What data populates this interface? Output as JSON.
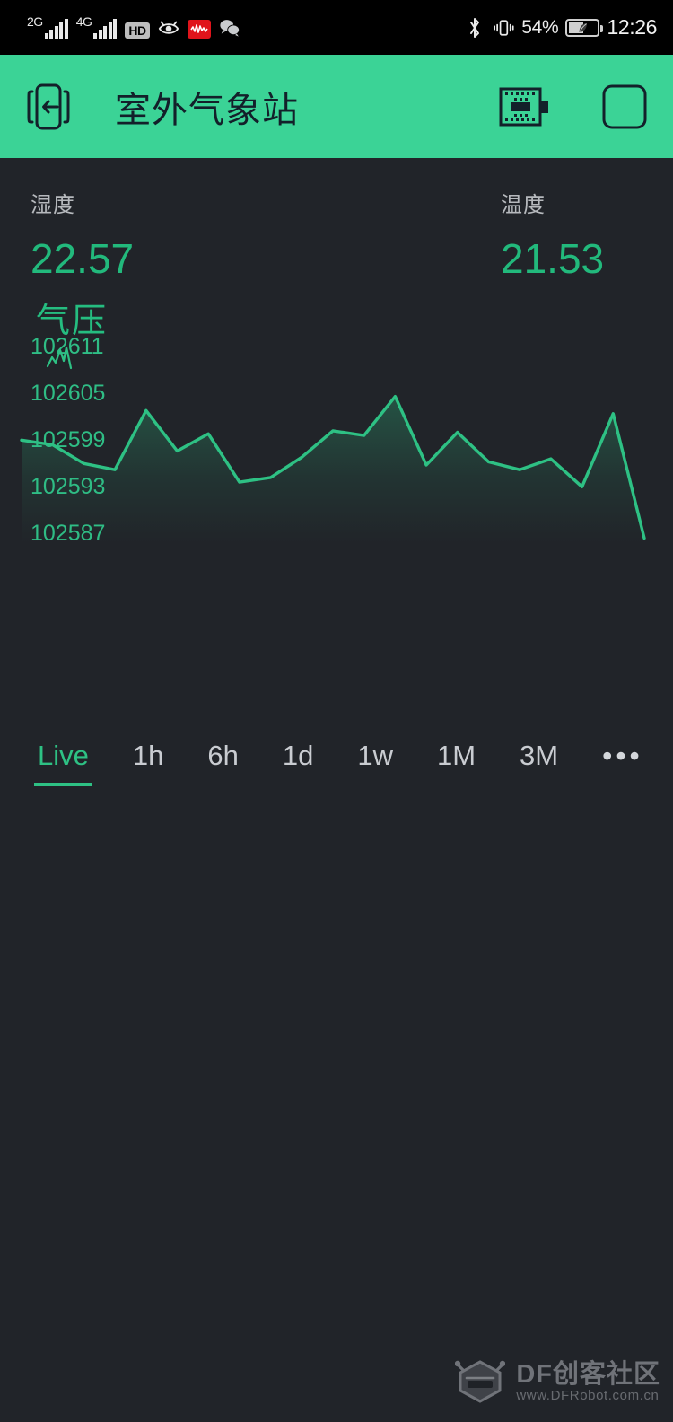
{
  "status_bar": {
    "network_2g_label": "2G",
    "network_4g_label": "4G",
    "hd_label": "HD",
    "battery_percent": "54%",
    "clock": "12:26",
    "icons": [
      "signal-2g-icon",
      "signal-4g-icon",
      "hd-icon",
      "eye-comfort-icon",
      "audio-recorder-icon",
      "wechat-icon",
      "bluetooth-icon",
      "vibrate-icon",
      "battery-saver-icon"
    ]
  },
  "app_bar": {
    "title": "室外气象站",
    "back_icon": "device-back-icon",
    "board_icon": "microcontroller-board-icon",
    "square_icon": "blank-square-icon",
    "background_color": "#3bd396",
    "foreground_color": "#13202a"
  },
  "readouts": [
    {
      "label": "湿度",
      "value": "22.57",
      "name": "humidity"
    },
    {
      "label": "温度",
      "value": "21.53",
      "name": "temperature"
    }
  ],
  "chart_panel": {
    "title": "气压",
    "glyph": "line-chart-icon",
    "accent_color": "#2ec184",
    "background_color": "#212429"
  },
  "tabs": [
    {
      "label": "Live",
      "active": true
    },
    {
      "label": "1h",
      "active": false
    },
    {
      "label": "6h",
      "active": false
    },
    {
      "label": "1d",
      "active": false
    },
    {
      "label": "1w",
      "active": false
    },
    {
      "label": "1M",
      "active": false
    },
    {
      "label": "3M",
      "active": false
    },
    {
      "label": "•••",
      "active": false
    },
    {
      "label": "",
      "active": false
    }
  ],
  "watermark": {
    "title": "DF创客社区",
    "url": "www.DFRobot.com.cn",
    "logo": "robot-head-icon"
  },
  "chart_data": {
    "type": "line",
    "title": "气压",
    "xlabel": "",
    "ylabel": "",
    "ylim": [
      102584,
      102614
    ],
    "yticks": [
      102611,
      102605,
      102599,
      102593,
      102587
    ],
    "ytick_labels": [
      "102611",
      "102605",
      "102599",
      "102593",
      "102587"
    ],
    "grid": false,
    "legend": "none",
    "current_value": "102611",
    "series": [
      {
        "name": "气压",
        "values": [
          102599.2,
          102598.6,
          102596.2,
          102595.4,
          102603.0,
          102597.8,
          102600.0,
          102593.8,
          102594.4,
          102597.0,
          102600.4,
          102599.8,
          102604.8,
          102596.0,
          102600.2,
          102596.4,
          102595.4,
          102596.8,
          102593.2,
          102602.6,
          102586.6
        ]
      }
    ]
  }
}
